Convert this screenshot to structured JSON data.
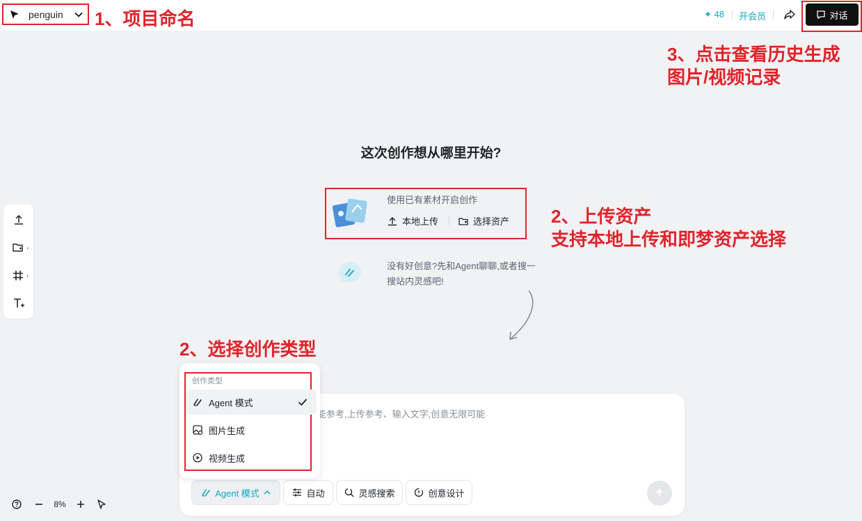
{
  "project": {
    "name": "penguin"
  },
  "annotations": {
    "a1": "1、项目命名",
    "a2": "2、上传资产\n支持本地上传和即梦资产选择",
    "a3": "2、选择创作类型",
    "a4": "3、点击查看历史生成\n图片/视频记录"
  },
  "header": {
    "credits": "✦ 48",
    "vip_label": "开会员",
    "chat_label": "对话"
  },
  "main": {
    "heading": "这次创作想从哪里开始?",
    "asset": {
      "title": "使用已有素材开启创作",
      "upload_label": "本地上传",
      "select_label": "选择资产"
    },
    "idea_text": "没有好创意?先和Agent聊聊,或者搜一搜站内灵感吧!"
  },
  "composer": {
    "placeholder": "能参考,上传参考、输入文字,创意无限可能",
    "mode_label": "Agent 模式",
    "auto_label": "自动",
    "inspire_label": "灵感搜索",
    "design_label": "创意设计"
  },
  "dropdown": {
    "header": "创作类型",
    "items": [
      {
        "label": "Agent 模式",
        "selected": true
      },
      {
        "label": "图片生成",
        "selected": false
      },
      {
        "label": "视频生成",
        "selected": false
      }
    ]
  },
  "canvas": {
    "zoom": "8%"
  },
  "colors": {
    "accent": "#14a6c4",
    "annotation": "#e0232b",
    "dark_button": "#111111"
  }
}
